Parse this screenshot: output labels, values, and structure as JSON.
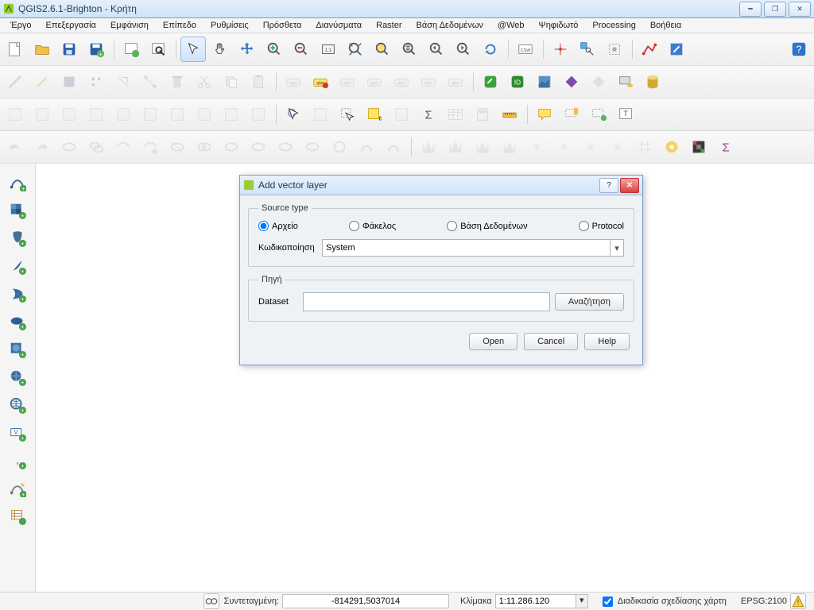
{
  "window_title": "QGIS2.6.1-Brighton - Κρήτη",
  "menus": [
    "Έργο",
    "Επεξεργασία",
    "Εμφάνιση",
    "Επίπεδο",
    "Ρυθμίσεις",
    "Πρόσθετα",
    "Διανύσματα",
    "Raster",
    "Βάση Δεδομένων",
    "@Web",
    "Ψηφιδωτό",
    "Processing",
    "Βοήθεια"
  ],
  "dialog": {
    "title": "Add vector layer",
    "group_source": "Source type",
    "radios": {
      "file": "Αρχείο",
      "directory": "Φάκελος",
      "database": "Βάση Δεδομένων",
      "protocol": "Protocol"
    },
    "encoding_label": "Κωδικοποίηση",
    "encoding_value": "System",
    "group_dataset": "Πηγή",
    "dataset_label": "Dataset",
    "browse": "Αναζήτηση",
    "open": "Open",
    "cancel": "Cancel",
    "help": "Help"
  },
  "status": {
    "coord_label": "Συντεταγμένη:",
    "coord_value": "-814291,5037014",
    "scale_label": "Κλίμακα",
    "scale_value": "1:11.286.120",
    "render_label": "Διαδικασία σχεδίασης χάρτη",
    "epsg": "EPSG:2100"
  }
}
